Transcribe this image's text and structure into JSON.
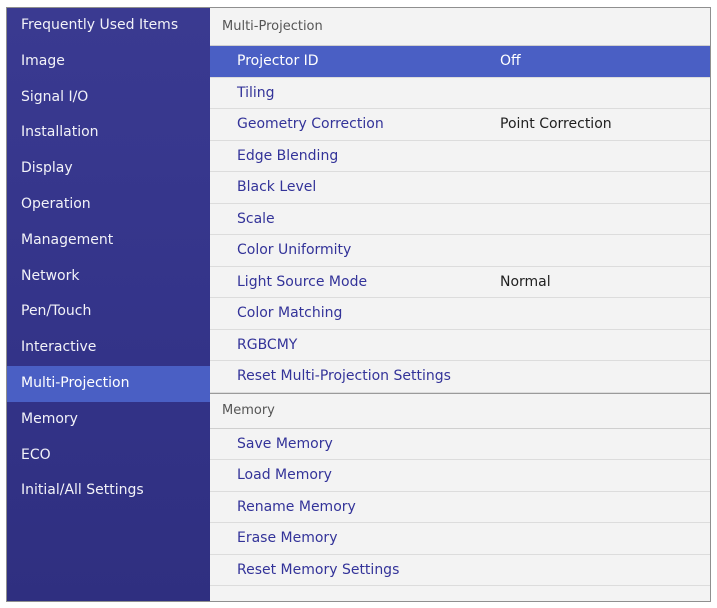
{
  "sidebar": {
    "items": [
      {
        "label": "Frequently Used Items"
      },
      {
        "label": "Image"
      },
      {
        "label": "Signal I/O"
      },
      {
        "label": "Installation"
      },
      {
        "label": "Display"
      },
      {
        "label": "Operation"
      },
      {
        "label": "Management"
      },
      {
        "label": "Network"
      },
      {
        "label": "Pen/Touch"
      },
      {
        "label": "Interactive"
      },
      {
        "label": "Multi-Projection"
      },
      {
        "label": "Memory"
      },
      {
        "label": "ECO"
      },
      {
        "label": "Initial/All Settings"
      }
    ],
    "active_index": 10
  },
  "multi_projection": {
    "title": "Multi-Projection",
    "items": [
      {
        "label": "Projector ID",
        "value": "Off"
      },
      {
        "label": "Tiling",
        "value": ""
      },
      {
        "label": "Geometry Correction",
        "value": "Point Correction"
      },
      {
        "label": "Edge Blending",
        "value": ""
      },
      {
        "label": "Black Level",
        "value": ""
      },
      {
        "label": "Scale",
        "value": ""
      },
      {
        "label": "Color Uniformity",
        "value": ""
      },
      {
        "label": "Light Source Mode",
        "value": "Normal"
      },
      {
        "label": "Color Matching",
        "value": ""
      },
      {
        "label": "RGBCMY",
        "value": ""
      },
      {
        "label": "Reset Multi-Projection Settings",
        "value": ""
      }
    ]
  },
  "memory": {
    "title": "Memory",
    "items": [
      {
        "label": "Save Memory"
      },
      {
        "label": "Load Memory"
      },
      {
        "label": "Rename Memory"
      },
      {
        "label": "Erase Memory"
      },
      {
        "label": "Reset Memory Settings"
      }
    ]
  },
  "colors": {
    "sidebar_bg": "#34348a",
    "highlight": "#4a5fc4",
    "item_text": "#333399",
    "panel_bg": "#f3f3f3"
  }
}
